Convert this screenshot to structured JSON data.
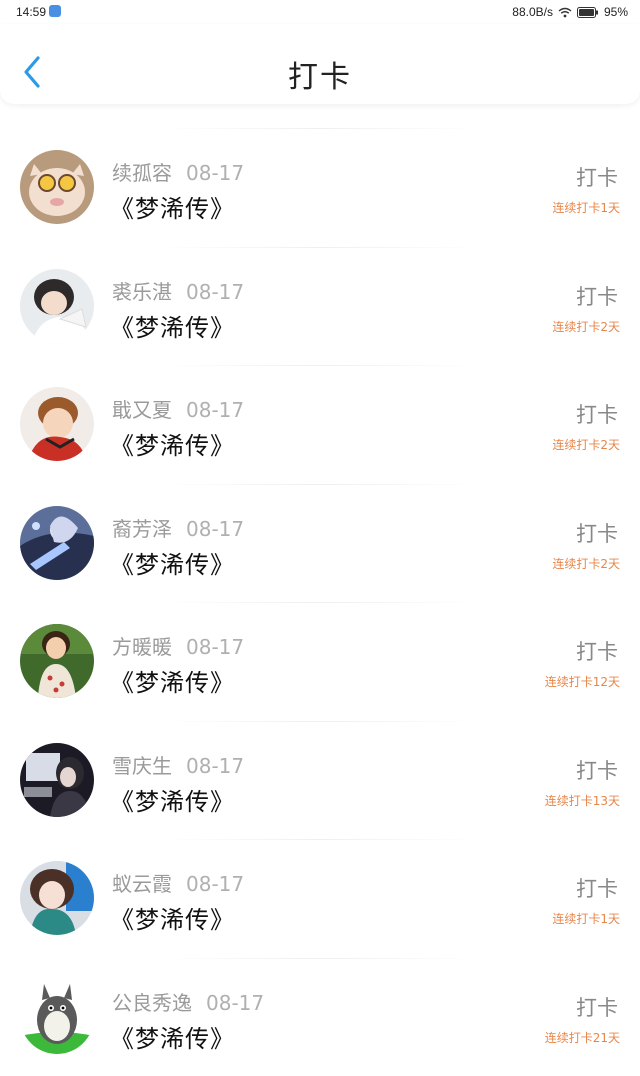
{
  "status": {
    "time": "14:59",
    "speed": "88.0B/s",
    "battery": "95%"
  },
  "header": {
    "title": "打卡"
  },
  "colors": {
    "accent": "#2b9ae8",
    "streak": "#e8864a"
  },
  "items": [
    {
      "name": "续孤容",
      "date": "08-17",
      "book": "《梦浠传》",
      "action": "打卡",
      "streak": "连续打卡1天"
    },
    {
      "name": "裘乐湛",
      "date": "08-17",
      "book": "《梦浠传》",
      "action": "打卡",
      "streak": "连续打卡2天"
    },
    {
      "name": "戢又夏",
      "date": "08-17",
      "book": "《梦浠传》",
      "action": "打卡",
      "streak": "连续打卡2天"
    },
    {
      "name": "裔芳泽",
      "date": "08-17",
      "book": "《梦浠传》",
      "action": "打卡",
      "streak": "连续打卡2天"
    },
    {
      "name": "方暖暖",
      "date": "08-17",
      "book": "《梦浠传》",
      "action": "打卡",
      "streak": "连续打卡12天"
    },
    {
      "name": "雪庆生",
      "date": "08-17",
      "book": "《梦浠传》",
      "action": "打卡",
      "streak": "连续打卡13天"
    },
    {
      "name": "蚁云霞",
      "date": "08-17",
      "book": "《梦浠传》",
      "action": "打卡",
      "streak": "连续打卡1天"
    },
    {
      "name": "公良秀逸",
      "date": "08-17",
      "book": "《梦浠传》",
      "action": "打卡",
      "streak": "连续打卡21天"
    }
  ]
}
